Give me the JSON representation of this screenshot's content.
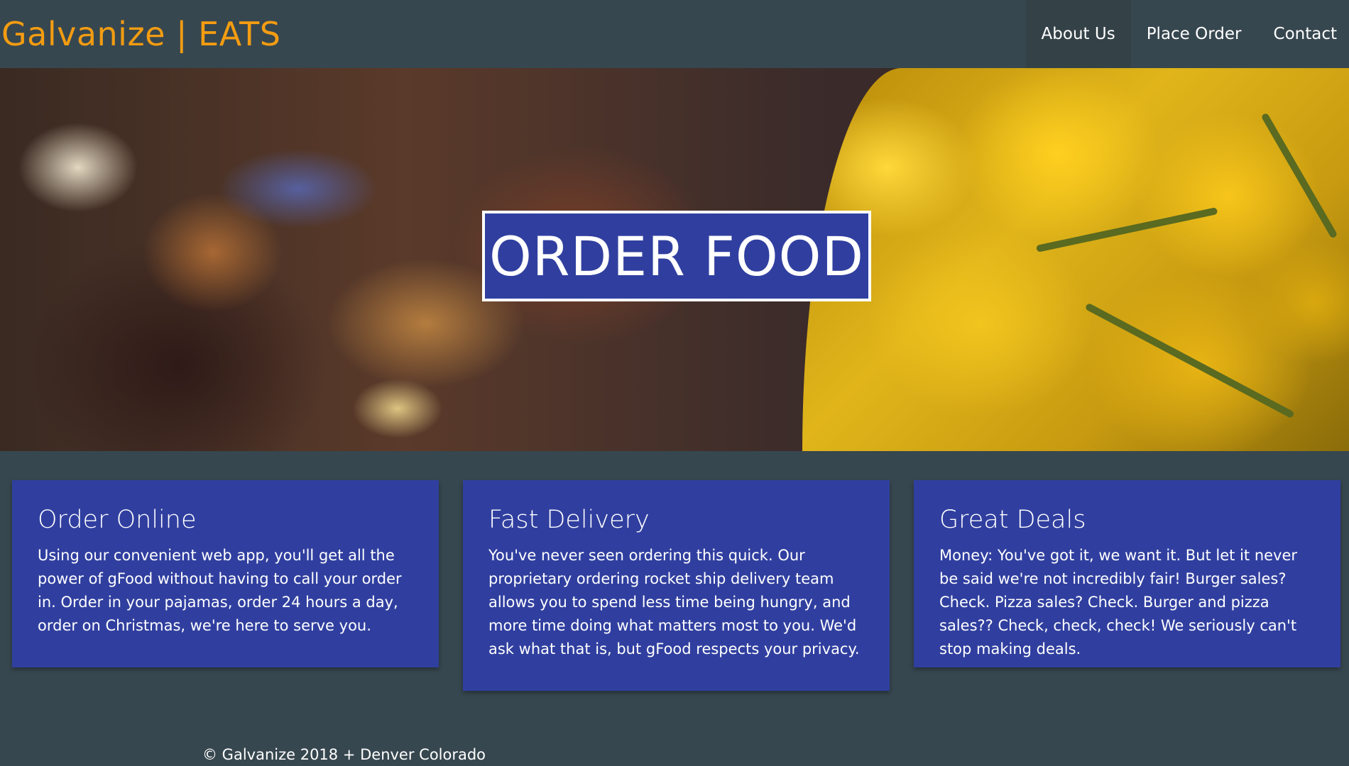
{
  "navbar": {
    "brand": "Galvanize | EATS",
    "links": [
      {
        "label": "About Us"
      },
      {
        "label": "Place Order"
      },
      {
        "label": "Contact"
      }
    ]
  },
  "hero": {
    "title": "ORDER FOOD"
  },
  "cards": [
    {
      "title": "Order Online",
      "text": "Using our convenient web app, you'll get all the power of gFood without having to call your order in. Order in your pajamas, order 24 hours a day, order on Christmas, we're here to serve you."
    },
    {
      "title": "Fast Delivery",
      "text": "You've never seen ordering this quick. Our proprietary ordering rocket ship delivery team allows you to spend less time being hungry, and more time doing what matters most to you. We'd ask what that is, but gFood respects your privacy."
    },
    {
      "title": "Great Deals",
      "text": "Money: You've got it, we want it. But let it never be said we're not incredibly fair! Burger sales? Check. Pizza sales? Check. Burger and pizza sales?? Check, check, check! We seriously can't stop making deals."
    }
  ],
  "footer": {
    "text": "© Galvanize 2018 + Denver Colorado"
  },
  "colors": {
    "background": "#37474f",
    "brand": "#f39c12",
    "primary": "#303f9f",
    "text": "#ffffff"
  }
}
